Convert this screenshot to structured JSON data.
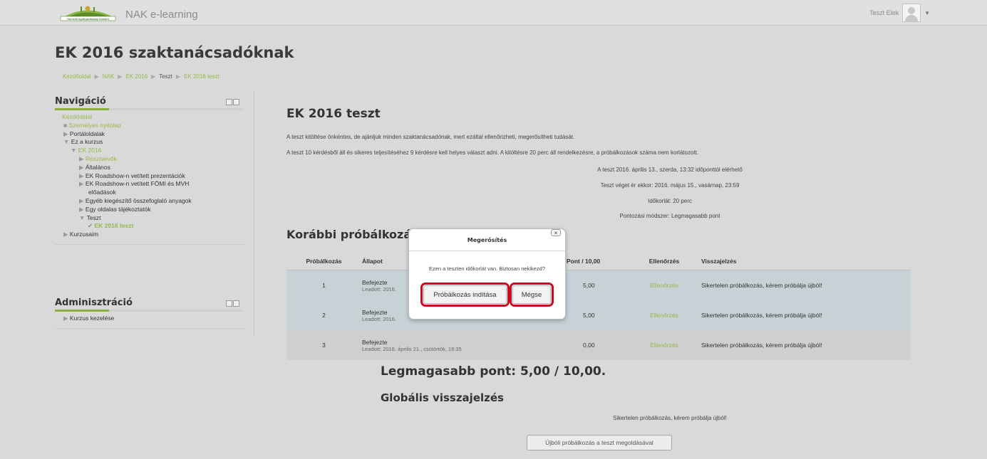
{
  "header": {
    "brand": "NAK e-learning",
    "user_name": "Teszt Elek",
    "logo_text": "Nemzeti Agrárgazdasági Kamara"
  },
  "course_title": "EK 2016 szaktanácsadóknak",
  "breadcrumb": [
    "Kezdőoldal",
    "NAK",
    "EK 2016",
    "Teszt",
    "EK 2016 teszt"
  ],
  "navigation": {
    "title": "Navigáció",
    "items": [
      "Kezdőoldal",
      "Személyes nyitólap",
      "Portáloldalak",
      "Ez a kurzus",
      "EK 2016",
      "Résztvevők",
      "Általános",
      "EK Roadshow-n vetített prezentációk",
      "EK Roadshow-n vetített FÖMI és MVH",
      "előadások",
      "Egyéb kiegészítő összefoglaló anyagok",
      "Egy oldalas tájékoztatók",
      "Teszt",
      "EK 2016 teszt",
      "Kurzusaim"
    ]
  },
  "administration": {
    "title": "Adminisztráció",
    "items": [
      "Kurzus kezelése"
    ]
  },
  "quiz": {
    "title": "EK 2016 teszt",
    "intro1": "A teszt kitöltése önkéntes, de ajánljuk minden szaktanácsadónak, mert ezáltal ellenőrizheti, megerősítheti tudását.",
    "intro2": "A teszt 10 kérdésből áll és sikeres teljesítéséhez 9 kérdésre kell helyes választ adni. A kitöltésre 20 perc áll rendelkezésre, a próbálkozások száma nem korlátozott.",
    "info": [
      "A teszt 2016. április 13., szerda, 13:32 időponttól elérhető",
      "Teszt véget ér ekkor: 2016. május 15., vasárnap, 23:59",
      "Időkorlát: 20 perc",
      "Pontozási módszer: Legmagasabb pont"
    ]
  },
  "attempts": {
    "title": "Korábbi próbálkozás",
    "headers": [
      "Próbálkozás",
      "Állapot",
      "Pont / 10,00",
      "Ellenőrzés",
      "Visszajelzés"
    ],
    "rows": [
      {
        "n": "1",
        "state": "Befejezte",
        "sub": "Leadott: 2016.",
        "grade": "5,00",
        "review": "Ellenőrzés",
        "feedback": "Sikertelen próbálkozás, kérem próbálja újból!"
      },
      {
        "n": "2",
        "state": "Befejezte",
        "sub": "Leadott: 2016.",
        "grade": "5,00",
        "review": "Ellenőrzés",
        "feedback": "Sikertelen próbálkozás, kérem próbálja újból!"
      },
      {
        "n": "3",
        "state": "Befejezte",
        "sub": "Leadott: 2016. április 21., csütörtök, 16:35",
        "grade": "0,00",
        "review": "Ellenőrzés",
        "feedback": "Sikertelen próbálkozás, kérem próbálja újból!"
      }
    ]
  },
  "best_grade": "Legmagasabb pont: 5,00 / 10,00.",
  "global_feedback": {
    "title": "Globális visszajelzés",
    "text": "Sikertelen próbálkozás, kérem próbálja újból!"
  },
  "retry_button": "Újbóli próbálkozás a teszt megoldásával",
  "dialog": {
    "title": "Megerősítés",
    "close": "×",
    "message": "Ezen a teszten időkorlát van. Biztosan nekikezd?",
    "start_button": "Próbálkozás indítása",
    "cancel_button": "Mégse",
    "highlight_color": "#c40f23"
  }
}
